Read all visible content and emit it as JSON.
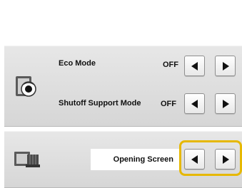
{
  "eco_mode": {
    "label": "Eco Mode",
    "value": "OFF"
  },
  "shutoff_support": {
    "label": "Shutoff Support Mode",
    "value": "OFF"
  },
  "opening_screen": {
    "label": "Opening Screen"
  },
  "icons": {
    "eco": "eco-mode-screen-icon",
    "opening": "opening-screen-icon",
    "arrow_left": "left-arrow-icon",
    "arrow_right": "right-arrow-icon"
  },
  "colors": {
    "highlight": "#e6b800",
    "panel": "#dcdcdc"
  }
}
